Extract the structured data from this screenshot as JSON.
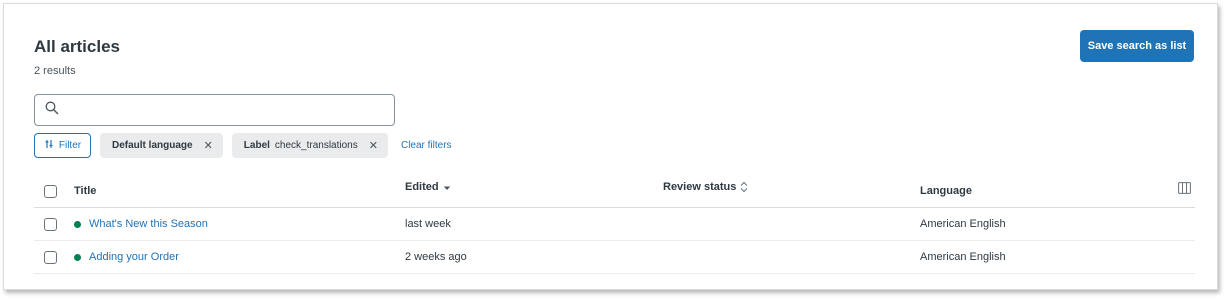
{
  "header": {
    "title": "All articles",
    "results": "2 results",
    "save_button": "Save search as list"
  },
  "search": {
    "value": "",
    "placeholder": ""
  },
  "filters": {
    "filter_button": "Filter",
    "chips": [
      {
        "label": "Default language",
        "value": ""
      },
      {
        "label": "Label",
        "value": "check_translations"
      }
    ],
    "clear": "Clear filters"
  },
  "table": {
    "columns": [
      "Title",
      "Edited",
      "Review status",
      "Language"
    ],
    "sort": {
      "column": "Edited",
      "direction": "descending"
    },
    "rows": [
      {
        "status_color": "#038153",
        "title": "What's New this Season",
        "edited": "last week",
        "review_status": "",
        "language": "American English"
      },
      {
        "status_color": "#038153",
        "title": "Adding your Order",
        "edited": "2 weeks ago",
        "review_status": "",
        "language": "American English"
      }
    ]
  },
  "colors": {
    "accent": "#1f73b7",
    "published": "#038153"
  }
}
